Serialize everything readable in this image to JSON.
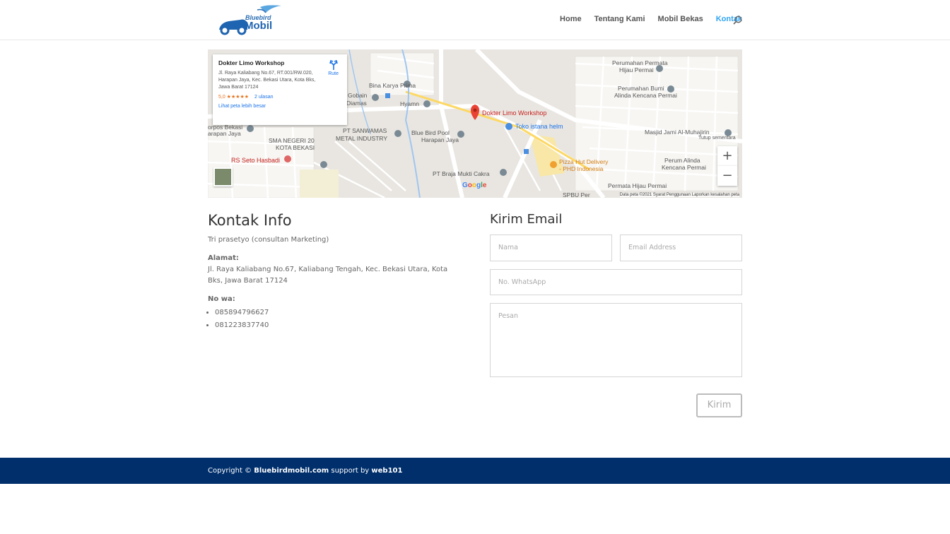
{
  "header": {
    "logo_line1": "Bluebird",
    "logo_line2": "Mobil",
    "nav": [
      {
        "label": "Home"
      },
      {
        "label": "Tentang Kami"
      },
      {
        "label": "Mobil Bekas"
      },
      {
        "label": "Kontak"
      }
    ]
  },
  "map": {
    "card": {
      "title": "Dokter Limo Workshop",
      "address": "Jl. Raya Kaliabang No.67, RT.001/RW.020, Harapan Jaya, Kec. Bekasi Utara, Kota Bks, Jawa Barat 17124",
      "rating": "5,0 ★★★★★",
      "reviews": "2 ulasan",
      "larger_map": "Lihat peta lebih besar",
      "directions": "Rute"
    },
    "labels": {
      "pin": "Dokter Limo Workshop",
      "toko": "Toko istana helm",
      "bina": "Bina Karya Prima",
      "gobain": "Gobain",
      "diamas": "Diamas",
      "hyamn": "Hyamn",
      "sanwamas1": "PT SANWAMAS",
      "sanwamas2": "METAL INDUSTRY",
      "bluebird1": "Blue Bird Pool",
      "bluebird2": "Harapan Jaya",
      "sma1": "SMA NEGERI 20",
      "sma2": "KOTA BEKASI",
      "rs": "RS Seto Hasbadi",
      "braja": "PT Braja Mukti Cakra",
      "pizza1": "Pizza Hut Delivery",
      "pizza2": "- PHD Indonesia",
      "perumahan1": "Perumahan Permata",
      "perumahan2": "Hijau Permai",
      "bumi1": "Perumahan Bumi",
      "bumi2": "Alinda Kencana Permai",
      "masjid1": "Masjid Jami Al-Muhajirin",
      "masjid2": "Tutup sementara",
      "alinda1": "Perum Alinda",
      "alinda2": "Kencana Permai",
      "permata": "Permata Hijau Permai",
      "spbu": "SPBU Per",
      "orpos1": "orpos Bekasi",
      "orpos2": "arapan Jaya"
    },
    "google": "Google",
    "attribution": "Data peta ©2021    Syarat Penggunaan    Laporkan kesalahan peta",
    "zoom_in": "+",
    "zoom_out": "−"
  },
  "contact": {
    "heading": "Kontak Info",
    "person": "Tri prasetyo (consultan Marketing)",
    "address_label": "Alamat:",
    "address": "Jl. Raya Kaliabang No.67, Kaliabang Tengah, Kec. Bekasi Utara, Kota Bks, Jawa Barat 17124",
    "phone_label": "No wa:",
    "phones": [
      "085894796627",
      "081223837740"
    ]
  },
  "form": {
    "heading": "Kirim Email",
    "name_placeholder": "Nama",
    "email_placeholder": "Email Address",
    "whatsapp_placeholder": "No. WhatsApp",
    "message_placeholder": "Pesan",
    "submit": "Kirim"
  },
  "footer": {
    "prefix": "Copyright © ",
    "site": "Bluebirdmobil.com",
    "middle": " support by ",
    "by": "web101"
  },
  "colors": {
    "nav_active": "#2ea3f2",
    "footer_bg": "#002f6c",
    "map_pin": "#ea4335"
  }
}
